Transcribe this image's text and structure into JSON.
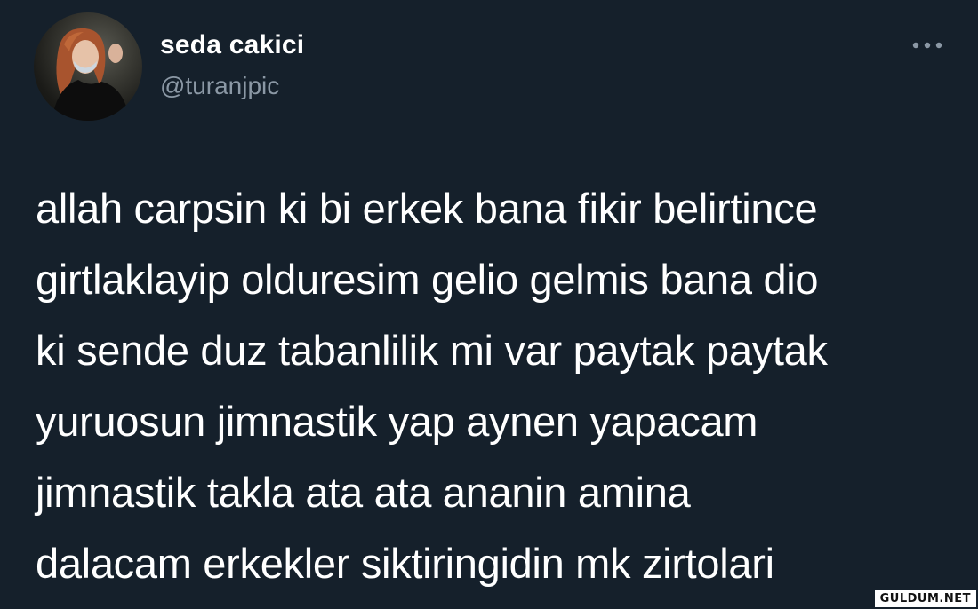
{
  "author": {
    "display_name": "seda cakici",
    "handle": "@turanjpic"
  },
  "icons": {
    "avatar": "avatar",
    "more": "more-horizontal-icon"
  },
  "tweet": {
    "lines": [
      "allah carpsin ki bi erkek bana fikir belirtince",
      "girtlaklayip olduresim gelio gelmis bana dio",
      "ki sende duz tabanlilik mi var paytak paytak",
      "yuruosun jimnastik yap aynen yapacam",
      "jimnastik takla ata ata ananin amina",
      "dalacam erkekler siktiringidin mk zirtolari"
    ]
  },
  "watermark": "GULDUM.NET",
  "colors": {
    "background": "#15202b",
    "text": "#ffffff",
    "secondary_text": "#8b98a5"
  }
}
